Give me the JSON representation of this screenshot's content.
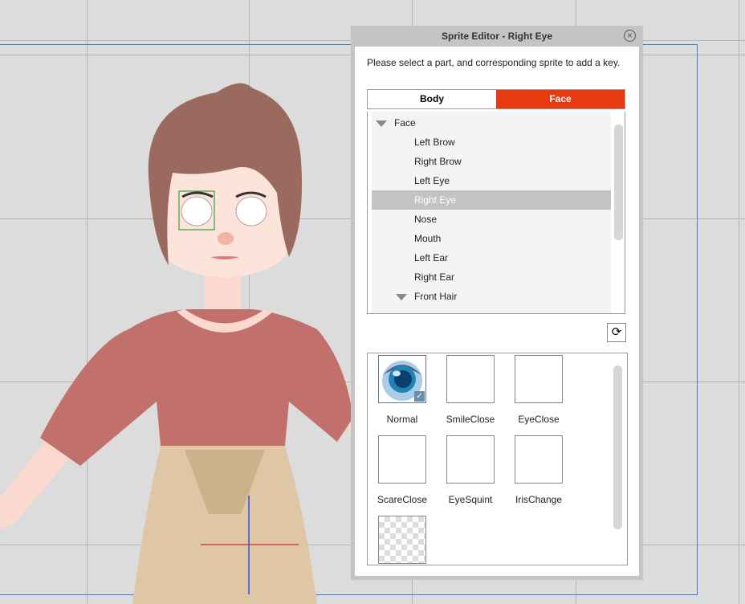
{
  "dialog": {
    "title": "Sprite Editor - Right Eye",
    "instruction": "Please select a part, and corresponding sprite to add a key.",
    "tabs": [
      {
        "label": "Body",
        "active": false
      },
      {
        "label": "Face",
        "active": true
      }
    ],
    "accent_color": "#e83a10",
    "tree": [
      {
        "label": "Face",
        "level": 0,
        "expandable": true
      },
      {
        "label": "Left Brow",
        "level": 1
      },
      {
        "label": "Right Brow",
        "level": 1
      },
      {
        "label": "Left Eye",
        "level": 1
      },
      {
        "label": "Right Eye",
        "level": 1,
        "selected": true
      },
      {
        "label": "Nose",
        "level": 1
      },
      {
        "label": "Mouth",
        "level": 1
      },
      {
        "label": "Left Ear",
        "level": 1
      },
      {
        "label": "Right Ear",
        "level": 1
      },
      {
        "label": "Front Hair",
        "level": 1,
        "expandable": true
      }
    ],
    "sprites": [
      {
        "label": "Normal",
        "selected": true
      },
      {
        "label": "SmileClose"
      },
      {
        "label": "EyeClose"
      },
      {
        "label": "ScareClose"
      },
      {
        "label": "EyeSquint"
      },
      {
        "label": "IrisChange"
      },
      {
        "label": ""
      }
    ]
  }
}
